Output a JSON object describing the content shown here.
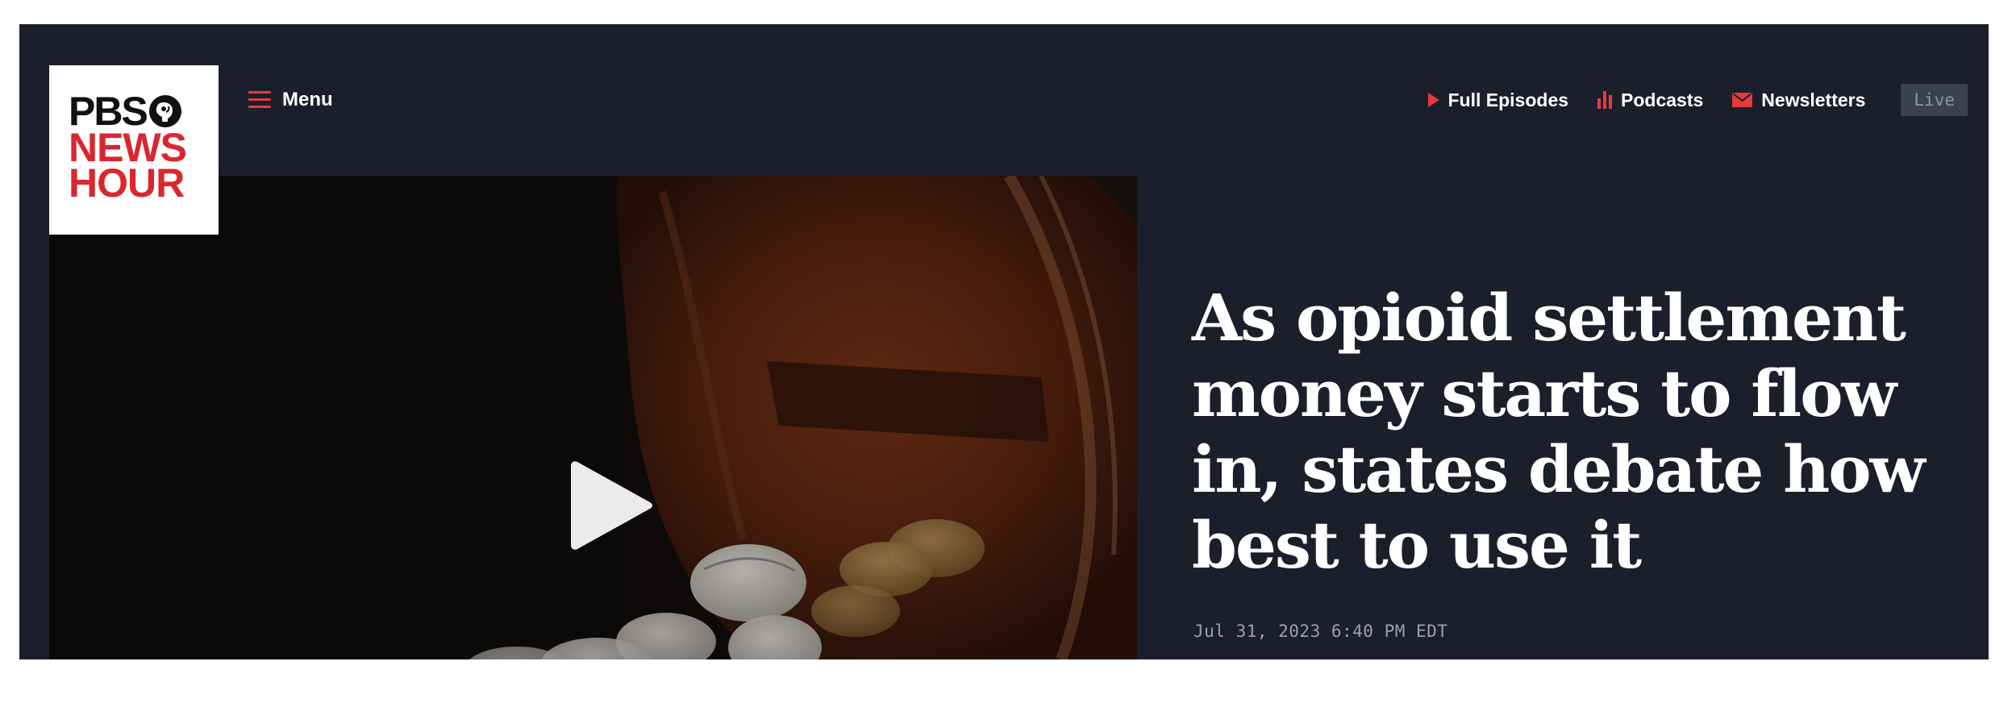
{
  "brand": {
    "logo_line1": "PBS",
    "logo_line2": "NEWS",
    "logo_line3": "HOUR",
    "accent_color": "#d8272d"
  },
  "header": {
    "menu_label": "Menu",
    "nav": [
      {
        "label": "Full Episodes",
        "icon": "play-icon"
      },
      {
        "label": "Podcasts",
        "icon": "podcast-bars-icon"
      },
      {
        "label": "Newsletters",
        "icon": "envelope-icon"
      }
    ],
    "live_label": "Live"
  },
  "article": {
    "headline": "As opioid settlement money starts to flow in, states debate how best to use it",
    "dateline": "Jul 31, 2023 6:40 PM EDT"
  },
  "video": {
    "play_icon": "play-button-icon",
    "background_color": "#1a1f2b"
  }
}
